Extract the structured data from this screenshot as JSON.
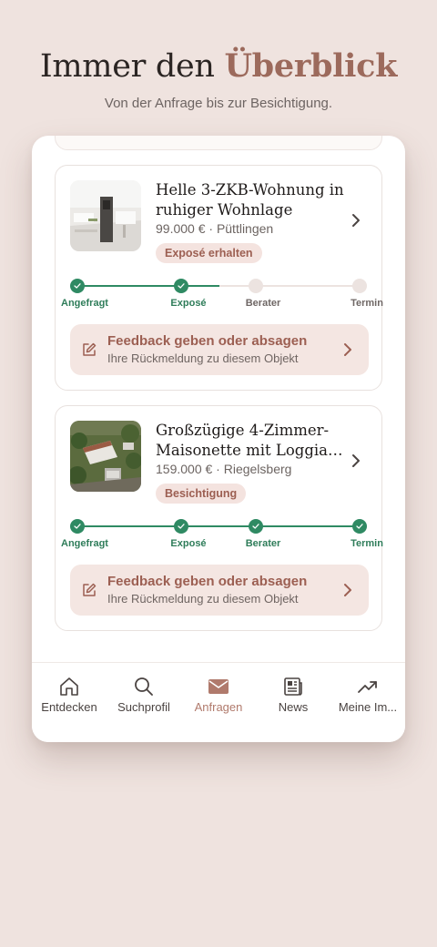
{
  "headline": {
    "prefix": "Immer den ",
    "accent": "Überblick"
  },
  "subline": "Von der Anfrage bis zur Besichtigung.",
  "listings": [
    {
      "title": "Helle 3-ZKB-Wohnung in ruhiger Wohnlage",
      "meta": "99.000 € · Püttlingen",
      "badge": "Exposé erhalten",
      "steps": [
        {
          "label": "Angefragt",
          "done": true
        },
        {
          "label": "Exposé",
          "done": true
        },
        {
          "label": "Berater",
          "done": false
        },
        {
          "label": "Termin",
          "done": false
        }
      ],
      "progress": 0.5,
      "feedback": {
        "title": "Feedback geben oder absagen",
        "subtitle": "Ihre Rückmeldung zu diesem Objekt"
      }
    },
    {
      "title": "Großzügige 4-Zimmer-Maisonette mit Loggia &...",
      "meta": "159.000 € · Riegelsberg",
      "badge": "Besichtigung",
      "steps": [
        {
          "label": "Angefragt",
          "done": true
        },
        {
          "label": "Exposé",
          "done": true
        },
        {
          "label": "Berater",
          "done": true
        },
        {
          "label": "Termin",
          "done": true
        }
      ],
      "progress": 1.0,
      "feedback": {
        "title": "Feedback geben oder absagen",
        "subtitle": "Ihre Rückmeldung zu diesem Objekt"
      }
    }
  ],
  "tabs": [
    {
      "label": "Entdecken",
      "icon": "home-icon"
    },
    {
      "label": "Suchprofil",
      "icon": "search-icon"
    },
    {
      "label": "Anfragen",
      "icon": "mail-icon",
      "active": true
    },
    {
      "label": "News",
      "icon": "newspaper-icon"
    },
    {
      "label": "Meine Im...",
      "icon": "trending-up-icon"
    }
  ],
  "colors": {
    "background": "#efe3df",
    "accent": "#9c6a5c",
    "success": "#2f8a63",
    "badge_bg": "#f4e3df",
    "active_tab": "#b07a6c"
  }
}
